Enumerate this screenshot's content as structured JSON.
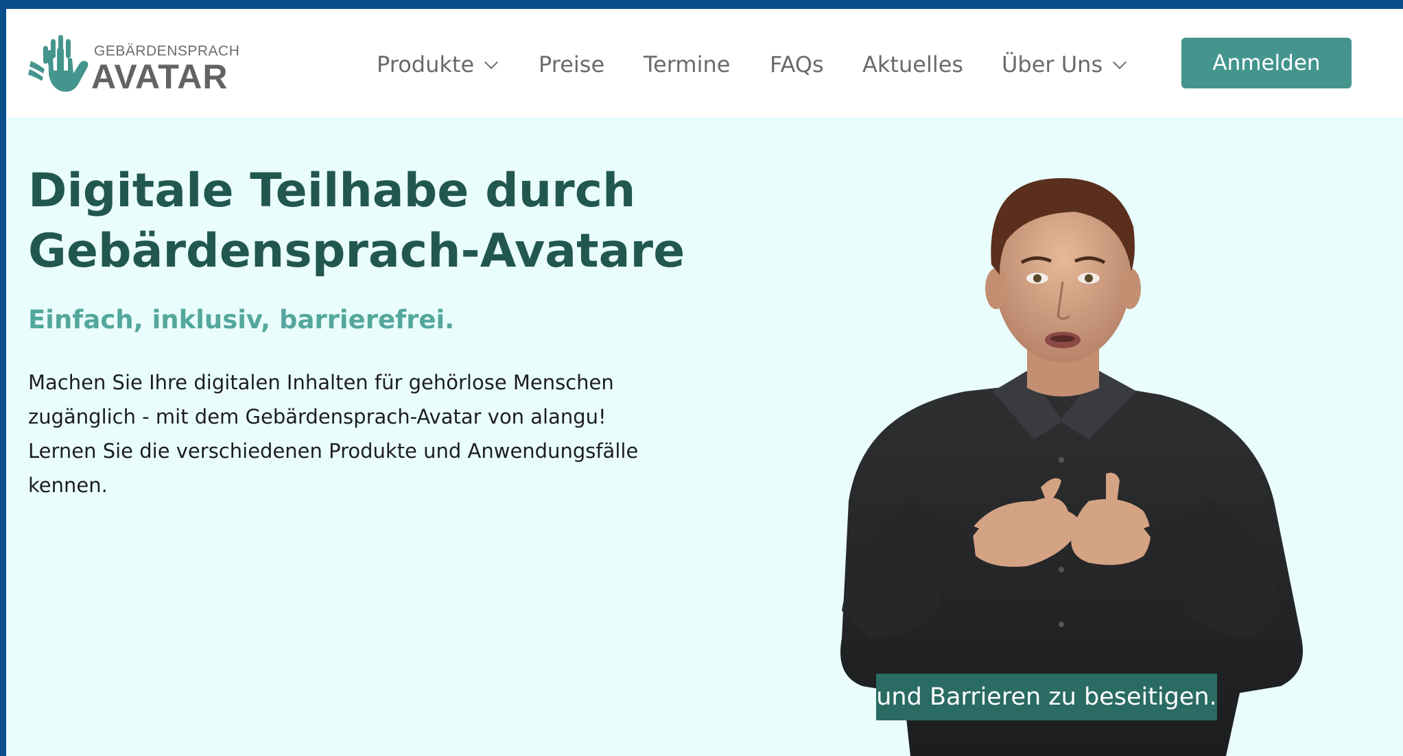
{
  "logo": {
    "small_text": "GEBÄRDENSPRACH",
    "big_text": "AVATAR"
  },
  "nav": {
    "items": [
      {
        "label": "Produkte",
        "has_dropdown": true
      },
      {
        "label": "Preise",
        "has_dropdown": false
      },
      {
        "label": "Termine",
        "has_dropdown": false
      },
      {
        "label": "FAQs",
        "has_dropdown": false
      },
      {
        "label": "Aktuelles",
        "has_dropdown": false
      },
      {
        "label": "Über Uns",
        "has_dropdown": true
      }
    ],
    "login_label": "Anmelden"
  },
  "hero": {
    "title_line1": "Digitale Teilhabe durch",
    "title_line2": "Gebärdensprach-Avatare",
    "subtitle": "Einfach, inklusiv, barrierefrei.",
    "body_line1": "Machen Sie Ihre digitalen Inhalten für gehörlose Menschen",
    "body_line2": "zugänglich - mit dem Gebärdensprach-Avatar von alangu!",
    "body_line3": "Lernen Sie die verschiedenen Produkte und Anwendungsfälle",
    "body_line4": "kennen."
  },
  "video": {
    "caption": "und Barrieren zu beseitigen."
  },
  "colors": {
    "accent": "#43958d",
    "title": "#21574f",
    "subtitle": "#54a79c",
    "background": "#e9fdfd",
    "frame": "#0b4e8c"
  }
}
